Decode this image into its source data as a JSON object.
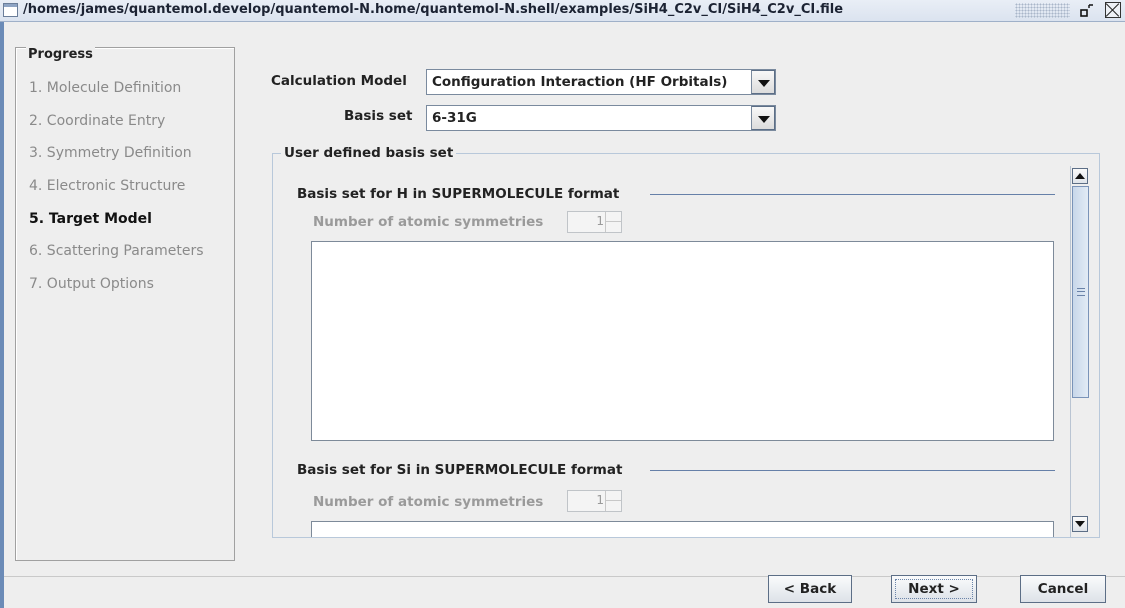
{
  "window": {
    "title": "/homes/james/quantemol.develop/quantemol-N.home/quantemol-N.shell/examples/SiH4_C2v_CI/SiH4_C2v_CI.file"
  },
  "progress": {
    "title": "Progress",
    "steps": [
      {
        "label": "1. Molecule Definition",
        "active": false
      },
      {
        "label": "2. Coordinate Entry",
        "active": false
      },
      {
        "label": "3. Symmetry Definition",
        "active": false
      },
      {
        "label": "4. Electronic Structure",
        "active": false
      },
      {
        "label": "5. Target Model",
        "active": true
      },
      {
        "label": "6. Scattering Parameters",
        "active": false
      },
      {
        "label": "7. Output Options",
        "active": false
      }
    ]
  },
  "form": {
    "calc_model_label": "Calculation Model",
    "calc_model_value": "Configuration Interaction (HF Orbitals)",
    "basis_label": "Basis set",
    "basis_value": "6-31G"
  },
  "user_basis": {
    "title": "User defined basis set",
    "sections": [
      {
        "title": "Basis set for H in SUPERMOLECULE format",
        "num_label": "Number of atomic symmetries",
        "num_value": "1"
      },
      {
        "title": "Basis set for Si in SUPERMOLECULE format",
        "num_label": "Number of atomic symmetries",
        "num_value": "1"
      }
    ]
  },
  "buttons": {
    "back": "< Back",
    "next": "Next >",
    "cancel": "Cancel"
  },
  "colors": {
    "window_border": "#6b8bb7",
    "separator_line": "#6680a8",
    "disabled_text": "#9a9a9a"
  }
}
